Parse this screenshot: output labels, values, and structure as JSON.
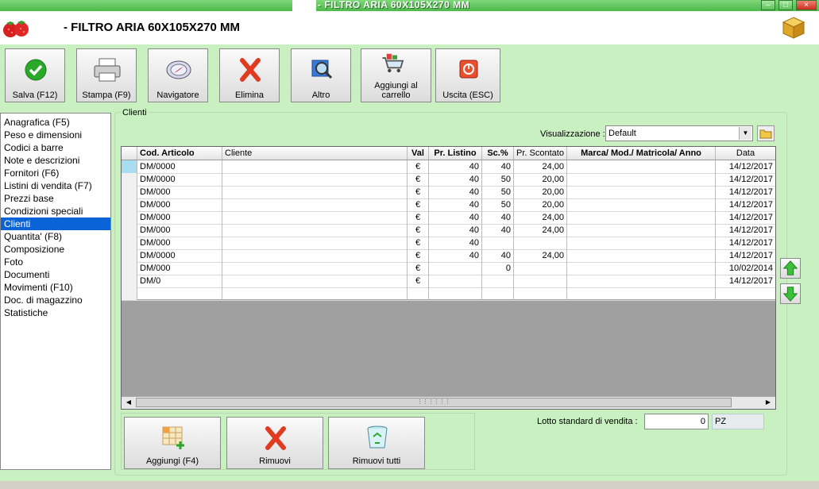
{
  "window": {
    "title": "- FILTRO ARIA 60X105X270 MM",
    "min": "–",
    "max": "□",
    "close": "×"
  },
  "header": {
    "title": "- FILTRO ARIA 60X105X270 MM"
  },
  "toolbar": [
    {
      "id": "salva",
      "label": "Salva (F12)",
      "icon": "check-icon"
    },
    {
      "id": "stampa",
      "label": "Stampa (F9)",
      "icon": "printer-icon"
    },
    {
      "id": "navigatore",
      "label": "Navigatore",
      "icon": "compass-icon"
    },
    {
      "id": "elimina",
      "label": "Elimina",
      "icon": "red-x-icon"
    },
    {
      "id": "altro",
      "label": "Altro",
      "icon": "magnifier-icon"
    },
    {
      "id": "carrello",
      "label": "Aggiungi al carrello",
      "icon": "cart-icon"
    },
    {
      "id": "uscita",
      "label": "Uscita (ESC)",
      "icon": "power-icon"
    }
  ],
  "sidebar": {
    "items": [
      "Anagrafica (F5)",
      "Peso e dimensioni",
      "Codici a barre",
      "Note e descrizioni",
      "Fornitori (F6)",
      "Listini di vendita (F7)",
      "Prezzi base",
      "Condizioni speciali",
      "Clienti",
      "Quantita' (F8)",
      "Composizione",
      "Foto",
      "Documenti",
      "Movimenti (F10)",
      "Doc. di magazzino",
      "Statistiche"
    ],
    "selected": 8
  },
  "panel": {
    "legend": "Clienti",
    "visualizzazione_label": "Visualizzazione :",
    "visualizzazione_value": "Default"
  },
  "table": {
    "columns": [
      "Cod. Articolo",
      "Cliente",
      "Val",
      "Pr. Listino",
      "Sc.%",
      "Pr. Scontato",
      "Marca/ Mod./ Matricola/ Anno",
      "Data"
    ],
    "rows": [
      {
        "cod": "DM/0000",
        "cliente": "",
        "val": "€",
        "listino": "40",
        "sc": "40",
        "scontato": "24,00",
        "marca": "",
        "data": "14/12/2017"
      },
      {
        "cod": "DM/0000",
        "cliente": "",
        "val": "€",
        "listino": "40",
        "sc": "50",
        "scontato": "20,00",
        "marca": "",
        "data": "14/12/2017"
      },
      {
        "cod": "DM/000",
        "cliente": "",
        "val": "€",
        "listino": "40",
        "sc": "50",
        "scontato": "20,00",
        "marca": "",
        "data": "14/12/2017"
      },
      {
        "cod": "DM/000",
        "cliente": "",
        "val": "€",
        "listino": "40",
        "sc": "50",
        "scontato": "20,00",
        "marca": "",
        "data": "14/12/2017"
      },
      {
        "cod": "DM/000",
        "cliente": "",
        "val": "€",
        "listino": "40",
        "sc": "40",
        "scontato": "24,00",
        "marca": "",
        "data": "14/12/2017"
      },
      {
        "cod": "DM/000",
        "cliente": "",
        "val": "€",
        "listino": "40",
        "sc": "40",
        "scontato": "24,00",
        "marca": "",
        "data": "14/12/2017"
      },
      {
        "cod": "DM/000",
        "cliente": "",
        "val": "€",
        "listino": "40",
        "sc": "",
        "scontato": "",
        "marca": "",
        "data": "14/12/2017"
      },
      {
        "cod": "DM/0000",
        "cliente": "",
        "val": "€",
        "listino": "40",
        "sc": "40",
        "scontato": "24,00",
        "marca": "",
        "data": "14/12/2017"
      },
      {
        "cod": "DM/000",
        "cliente": "",
        "val": "€",
        "listino": "",
        "sc": "0",
        "scontato": "",
        "marca": "",
        "data": "10/02/2014"
      },
      {
        "cod": "DM/0",
        "cliente": "",
        "val": "€",
        "listino": "",
        "sc": "",
        "scontato": "",
        "marca": "",
        "data": "14/12/2017"
      }
    ]
  },
  "bottom": {
    "aggiungi": "Aggiungi (F4)",
    "rimuovi": "Rimuovi",
    "rimuovi_tutti": "Rimuovi tutti",
    "lotto_label": "Lotto standard di vendita :",
    "lotto_value": "0",
    "lotto_unit": "PZ"
  },
  "colors": {
    "background": "#c8f0c0",
    "selection": "#0a64d8",
    "titlebar": "#4cb84a"
  }
}
